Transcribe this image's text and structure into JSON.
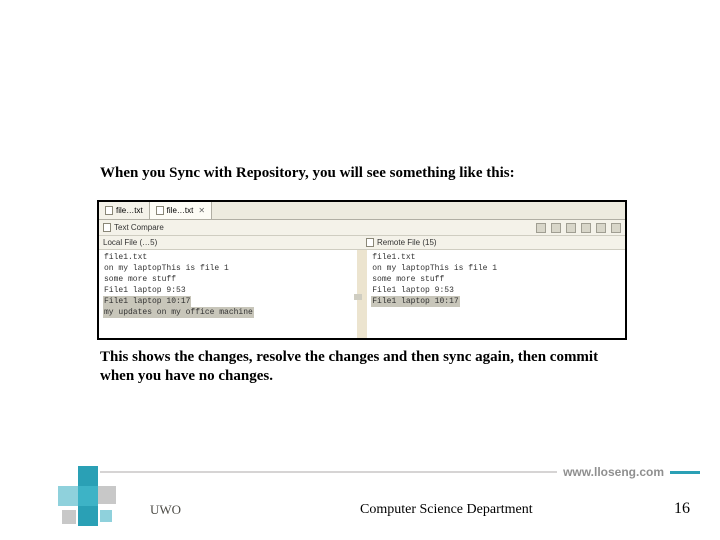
{
  "heading": "When you Sync with Repository, you will see something like this:",
  "caption": "This shows the changes, resolve the changes and then sync again, then commit when you have no changes.",
  "screenshot": {
    "tabs": [
      {
        "label": "file…txt"
      },
      {
        "label": "file…txt"
      }
    ],
    "compare_title": "Text Compare",
    "left_label": "Local File (…5)",
    "right_label": "Remote File (15)",
    "left_lines": [
      "file1.txt",
      "on my laptopThis is file 1",
      "some more stuff",
      "File1 laptop 9:53",
      "File1 laptop 10:17",
      "my updates on my office machine"
    ],
    "right_lines": [
      "file1.txt",
      "on my laptopThis is file 1",
      "some more stuff",
      "File1 laptop 9:53",
      "File1 laptop 10:17"
    ]
  },
  "footer": {
    "url": "www.lloseng.com",
    "org": "UWO",
    "dept": "Computer Science Department",
    "slide_number": "16"
  }
}
